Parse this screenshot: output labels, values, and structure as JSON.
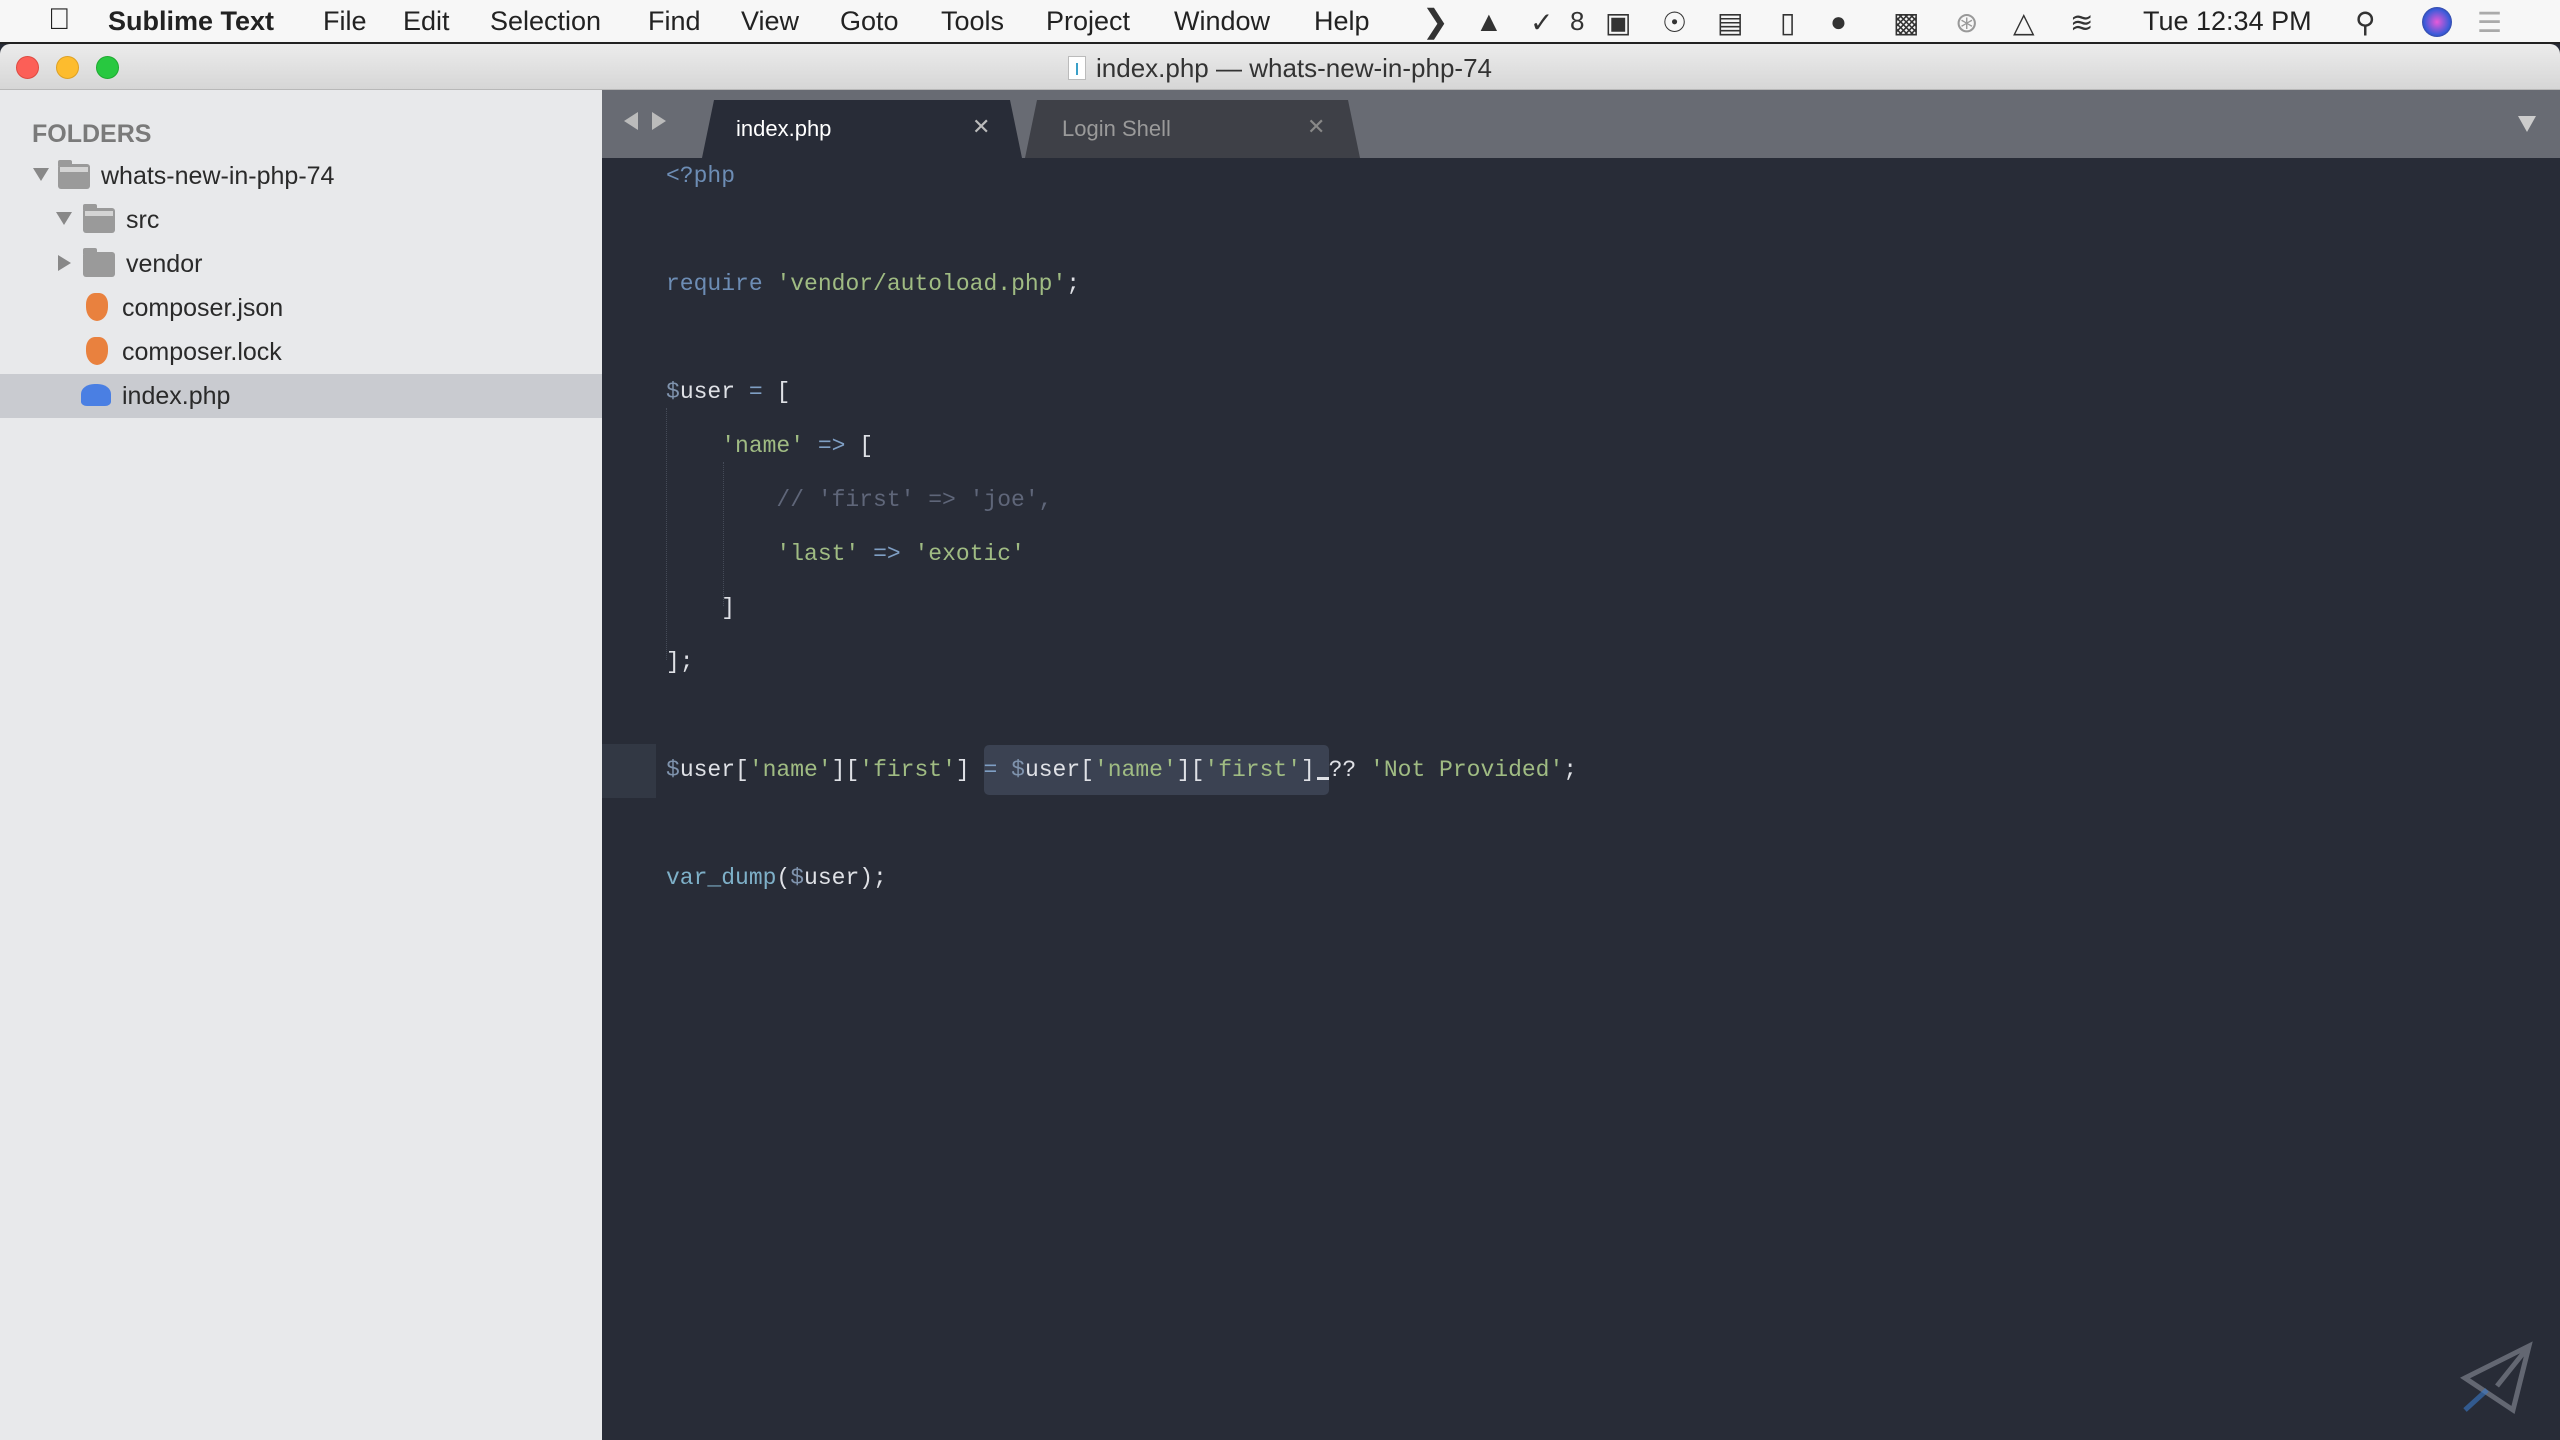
{
  "menubar": {
    "app": "Sublime Text",
    "items": [
      "File",
      "Edit",
      "Selection",
      "Find",
      "View",
      "Goto",
      "Tools",
      "Project",
      "Window",
      "Help"
    ],
    "badge_count": "8",
    "clock": "Tue 12:34 PM"
  },
  "window": {
    "title": "index.php — whats-new-in-php-74"
  },
  "sidebar": {
    "header": "FOLDERS",
    "items": [
      {
        "label": "whats-new-in-php-74",
        "icon": "folder-open-icon"
      },
      {
        "label": "src",
        "icon": "folder-open-icon"
      },
      {
        "label": "vendor",
        "icon": "folder-icon"
      },
      {
        "label": "composer.json",
        "icon": "composer-icon"
      },
      {
        "label": "composer.lock",
        "icon": "composer-icon"
      },
      {
        "label": "index.php",
        "icon": "php-elephant-icon",
        "selected": true
      }
    ]
  },
  "tabs": [
    {
      "label": "index.php",
      "active": true
    },
    {
      "label": "Login Shell",
      "active": false
    }
  ],
  "code": {
    "lines": [
      [
        [
          "kw",
          "<?php"
        ]
      ],
      [],
      [
        [
          "kw",
          "require"
        ],
        [
          "pl",
          " "
        ],
        [
          "str",
          "'vendor/autoload.php'"
        ],
        [
          "pl",
          ";"
        ]
      ],
      [],
      [
        [
          "var",
          "$"
        ],
        [
          "pl",
          "user "
        ],
        [
          "op",
          "="
        ],
        [
          "pl",
          " ["
        ]
      ],
      [
        [
          "pl",
          "    "
        ],
        [
          "str",
          "'name'"
        ],
        [
          "pl",
          " "
        ],
        [
          "op",
          "=>"
        ],
        [
          "pl",
          " ["
        ]
      ],
      [
        [
          "pl",
          "        "
        ],
        [
          "cm",
          "// 'first' => 'joe',"
        ]
      ],
      [
        [
          "pl",
          "        "
        ],
        [
          "str",
          "'last'"
        ],
        [
          "pl",
          " "
        ],
        [
          "op",
          "=>"
        ],
        [
          "pl",
          " "
        ],
        [
          "str",
          "'exotic'"
        ]
      ],
      [
        [
          "pl",
          "    ]"
        ]
      ],
      [
        [
          "pl",
          "];"
        ]
      ],
      [],
      [
        [
          "var",
          "$"
        ],
        [
          "pl",
          "user["
        ],
        [
          "str",
          "'name'"
        ],
        [
          "pl",
          "]["
        ],
        [
          "str",
          "'first'"
        ],
        [
          "pl",
          "] "
        ],
        [
          "sel-op",
          "="
        ],
        [
          "sel-pl",
          " "
        ],
        [
          "sel-var",
          "$"
        ],
        [
          "sel-pl",
          "user["
        ],
        [
          "sel-str",
          "'name'"
        ],
        [
          "sel-pl",
          "]["
        ],
        [
          "sel-str",
          "'first'"
        ],
        [
          "sel-pl",
          "] "
        ],
        [
          "cursor",
          ""
        ],
        [
          "pl",
          "?? "
        ],
        [
          "str",
          "'Not Provided'"
        ],
        [
          "pl",
          ";"
        ]
      ],
      [],
      [
        [
          "fn",
          "var_dump"
        ],
        [
          "pl",
          "("
        ],
        [
          "var",
          "$"
        ],
        [
          "pl",
          "user);"
        ]
      ]
    ]
  },
  "colors": {
    "editor_bg": "#282c37",
    "sidebar_bg": "#e8e9eb",
    "string": "#a0bc83",
    "keyword": "#6d8db5",
    "selection": "#3b4252"
  }
}
